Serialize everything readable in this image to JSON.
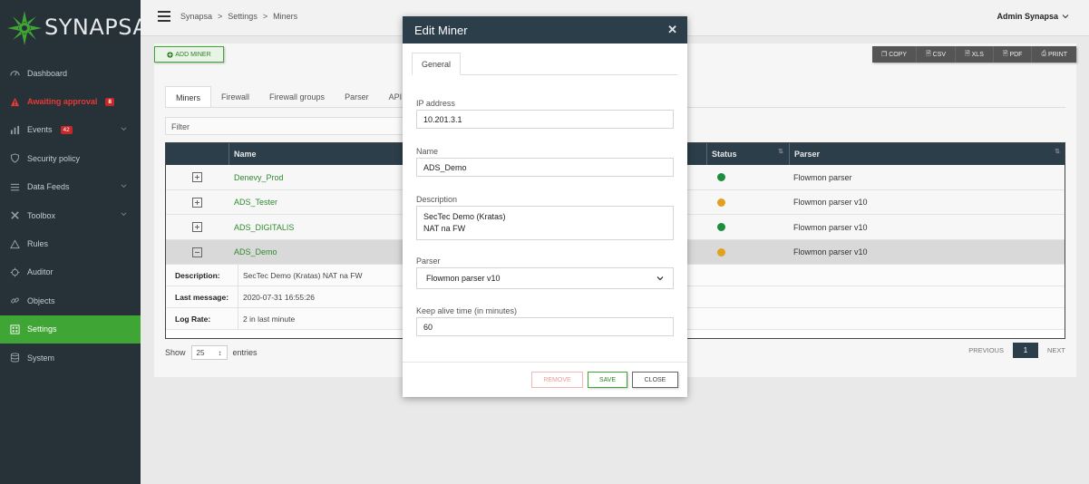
{
  "app": {
    "logo_text": "SYNAPSA"
  },
  "sidebar": {
    "items": [
      {
        "label": "Dashboard",
        "icon": "dashboard-icon"
      },
      {
        "label": "Awaiting approval",
        "icon": "warning-icon",
        "badge": "8"
      },
      {
        "label": "Events",
        "icon": "events-icon",
        "badge": "42"
      },
      {
        "label": "Security policy",
        "icon": "shield-icon"
      },
      {
        "label": "Data Feeds",
        "icon": "list-icon"
      },
      {
        "label": "Toolbox",
        "icon": "tools-icon"
      },
      {
        "label": "Rules",
        "icon": "rules-icon"
      },
      {
        "label": "Auditor",
        "icon": "auditor-icon"
      },
      {
        "label": "Objects",
        "icon": "objects-icon"
      },
      {
        "label": "Settings",
        "icon": "settings-icon"
      },
      {
        "label": "System",
        "icon": "system-icon"
      }
    ]
  },
  "header": {
    "breadcrumb": [
      "Synapsa",
      ">",
      "Settings",
      ">",
      "Miners"
    ],
    "user": "Admin Synapsa"
  },
  "toolbar": {
    "add_miner": "ADD MINER",
    "exports": [
      "COPY",
      "CSV",
      "XLS",
      "PDF",
      "PRINT"
    ]
  },
  "tabs": [
    "Miners",
    "Firewall",
    "Firewall groups",
    "Parser",
    "API"
  ],
  "filter_placeholder": "Filter",
  "table": {
    "headers": {
      "name": "Name",
      "status": "Status",
      "parser": "Parser"
    },
    "rows": [
      {
        "name": "Denevy_Prod",
        "status_color": "#1e8e3e",
        "parser": "Flowmon parser"
      },
      {
        "name": "ADS_Tester",
        "status_color": "#e0a020",
        "parser": "Flowmon parser v10"
      },
      {
        "name": "ADS_DIGITALIS",
        "status_color": "#1e8e3e",
        "parser": "Flowmon parser v10"
      },
      {
        "name": "ADS_Demo",
        "status_color": "#e0a020",
        "parser": "Flowmon parser v10"
      }
    ],
    "details": [
      {
        "label": "Description:",
        "value": "SecTec Demo (Kratas) NAT na FW"
      },
      {
        "label": "Last message:",
        "value": "2020-07-31 16:55:26"
      },
      {
        "label": "Log Rate:",
        "value": "2 in last minute"
      }
    ]
  },
  "pagination": {
    "show_label": "Show",
    "page_size": "25",
    "entries_label": "entries",
    "previous": "PREVIOUS",
    "current": "1",
    "next": "NEXT"
  },
  "modal": {
    "title": "Edit Miner",
    "tab": "General",
    "ip_label": "IP address",
    "ip_value": "10.201.3.1",
    "name_label": "Name",
    "name_value": "ADS_Demo",
    "description_label": "Description",
    "description_line1": "SecTec Demo (Kratas)",
    "description_line2": "NAT na FW",
    "parser_label": "Parser",
    "parser_value": "Flowmon parser v10",
    "keepalive_label": "Keep alive time (in minutes)",
    "keepalive_value": "60",
    "remove": "REMOVE",
    "save": "SAVE",
    "close": "CLOSE"
  }
}
